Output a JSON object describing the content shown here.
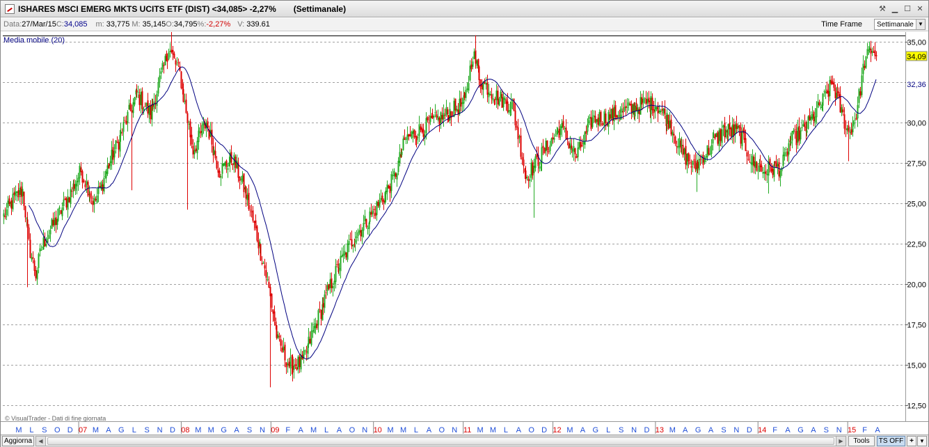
{
  "window": {
    "title": "ISHARES MSCI EMERG MKTS UCITS ETF (DIST) <34,085> -2,27%",
    "period": "(Settimanale)",
    "controls": [
      "tools-icon",
      "minimize-icon",
      "maximize-icon",
      "close-icon"
    ]
  },
  "info": {
    "date_label": "Data:",
    "date_value": "27/Mar/15",
    "close_label": "C:",
    "close_value": "34,085",
    "min_label": "m:",
    "min_value": "33,775",
    "max_label": "M:",
    "max_value": "35,145",
    "open_label": "O:",
    "open_value": "34,795",
    "pct_label": "%:",
    "pct_value": "-2,27%",
    "vol_label": "V:",
    "vol_value": "339.61",
    "timeframe_label": "Time Frame",
    "timeframe_value": "Settimanale"
  },
  "indicator_label": "Media mobile (20)",
  "watermark": "© VisualTrader - Dati di fine giornata",
  "statusbar": {
    "refresh": "Aggiorna",
    "tools": "Tools",
    "tsoff": "TS OFF",
    "plus": "+"
  },
  "colors": {
    "up": "#22aa22",
    "down": "#dd0000",
    "ma": "#000080",
    "grid": "#a0a0a0",
    "year": "#dd0000",
    "month": "#1f4ed8",
    "last_price_bg": "#ffff00"
  },
  "chart_data": {
    "type": "candlestick",
    "ylim": [
      11.5,
      35.6
    ],
    "yticks": [
      12.5,
      15.0,
      17.5,
      20.0,
      22.5,
      25.0,
      27.5,
      30.0,
      32.5,
      35.0
    ],
    "ytick_labels": [
      "12,50",
      "15,00",
      "17,50",
      "20,00",
      "22,50",
      "25,00",
      "27,50",
      "30,00",
      "32,50",
      "35,00"
    ],
    "last_price": 34.09,
    "last_price_label": "34,09",
    "ma_value": 32.36,
    "ma_label": "32,36",
    "ma_period": 20,
    "resistance": 35.38,
    "xticks": [
      {
        "l": "M",
        "y": false
      },
      {
        "l": "L",
        "y": false
      },
      {
        "l": "S",
        "y": false
      },
      {
        "l": "O",
        "y": false
      },
      {
        "l": "D",
        "y": false
      },
      {
        "l": "07",
        "y": true
      },
      {
        "l": "M",
        "y": false
      },
      {
        "l": "A",
        "y": false
      },
      {
        "l": "G",
        "y": false
      },
      {
        "l": "L",
        "y": false
      },
      {
        "l": "S",
        "y": false
      },
      {
        "l": "N",
        "y": false
      },
      {
        "l": "D",
        "y": false
      },
      {
        "l": "08",
        "y": true
      },
      {
        "l": "M",
        "y": false
      },
      {
        "l": "M",
        "y": false
      },
      {
        "l": "G",
        "y": false
      },
      {
        "l": "A",
        "y": false
      },
      {
        "l": "S",
        "y": false
      },
      {
        "l": "N",
        "y": false
      },
      {
        "l": "09",
        "y": true
      },
      {
        "l": "F",
        "y": false
      },
      {
        "l": "A",
        "y": false
      },
      {
        "l": "M",
        "y": false
      },
      {
        "l": "L",
        "y": false
      },
      {
        "l": "A",
        "y": false
      },
      {
        "l": "O",
        "y": false
      },
      {
        "l": "N",
        "y": false
      },
      {
        "l": "10",
        "y": true
      },
      {
        "l": "M",
        "y": false
      },
      {
        "l": "M",
        "y": false
      },
      {
        "l": "L",
        "y": false
      },
      {
        "l": "A",
        "y": false
      },
      {
        "l": "O",
        "y": false
      },
      {
        "l": "N",
        "y": false
      },
      {
        "l": "11",
        "y": true
      },
      {
        "l": "M",
        "y": false
      },
      {
        "l": "M",
        "y": false
      },
      {
        "l": "L",
        "y": false
      },
      {
        "l": "A",
        "y": false
      },
      {
        "l": "O",
        "y": false
      },
      {
        "l": "D",
        "y": false
      },
      {
        "l": "12",
        "y": true
      },
      {
        "l": "M",
        "y": false
      },
      {
        "l": "A",
        "y": false
      },
      {
        "l": "G",
        "y": false
      },
      {
        "l": "L",
        "y": false
      },
      {
        "l": "S",
        "y": false
      },
      {
        "l": "N",
        "y": false
      },
      {
        "l": "D",
        "y": false
      },
      {
        "l": "13",
        "y": true
      },
      {
        "l": "M",
        "y": false
      },
      {
        "l": "A",
        "y": false
      },
      {
        "l": "G",
        "y": false
      },
      {
        "l": "A",
        "y": false
      },
      {
        "l": "S",
        "y": false
      },
      {
        "l": "N",
        "y": false
      },
      {
        "l": "D",
        "y": false
      },
      {
        "l": "14",
        "y": true
      },
      {
        "l": "F",
        "y": false
      },
      {
        "l": "A",
        "y": false
      },
      {
        "l": "G",
        "y": false
      },
      {
        "l": "A",
        "y": false
      },
      {
        "l": "S",
        "y": false
      },
      {
        "l": "N",
        "y": false
      },
      {
        "l": "15",
        "y": true
      },
      {
        "l": "F",
        "y": false
      },
      {
        "l": "A",
        "y": false
      }
    ],
    "n_weeks": 460,
    "close_anchors": [
      [
        0,
        24.2
      ],
      [
        8,
        25.3
      ],
      [
        14,
        25.8
      ],
      [
        19,
        22.4
      ],
      [
        24,
        20.6
      ],
      [
        28,
        22.2
      ],
      [
        36,
        23.5
      ],
      [
        46,
        25.0
      ],
      [
        58,
        27.0
      ],
      [
        68,
        25.0
      ],
      [
        80,
        27.6
      ],
      [
        100,
        31.8
      ],
      [
        110,
        30.5
      ],
      [
        124,
        34.6
      ],
      [
        132,
        33.0
      ],
      [
        142,
        28.3
      ],
      [
        152,
        30.0
      ],
      [
        162,
        27.0
      ],
      [
        172,
        27.8
      ],
      [
        182,
        25.5
      ],
      [
        196,
        21.0
      ],
      [
        206,
        16.4
      ],
      [
        214,
        15.0
      ],
      [
        224,
        15.1
      ],
      [
        234,
        17.5
      ],
      [
        248,
        20.5
      ],
      [
        262,
        22.8
      ],
      [
        278,
        24.5
      ],
      [
        292,
        26.4
      ],
      [
        302,
        29.0
      ],
      [
        318,
        29.8
      ],
      [
        332,
        30.5
      ],
      [
        346,
        31.2
      ],
      [
        352,
        34.3
      ],
      [
        358,
        32.6
      ],
      [
        370,
        31.6
      ],
      [
        382,
        31.0
      ],
      [
        388,
        28.4
      ],
      [
        392,
        26.6
      ],
      [
        404,
        28.0
      ],
      [
        418,
        29.7
      ],
      [
        430,
        27.9
      ],
      [
        442,
        30.2
      ],
      [
        456,
        30.4
      ],
      [
        470,
        30.8
      ],
      [
        482,
        31.2
      ],
      [
        490,
        31.1
      ],
      [
        500,
        30.0
      ],
      [
        508,
        28.3
      ],
      [
        518,
        27.2
      ],
      [
        528,
        28.2
      ],
      [
        540,
        29.5
      ],
      [
        552,
        29.4
      ],
      [
        562,
        27.5
      ],
      [
        570,
        27.0
      ],
      [
        578,
        27.2
      ],
      [
        584,
        27.2
      ],
      [
        590,
        28.8
      ],
      [
        602,
        29.6
      ],
      [
        614,
        31.2
      ],
      [
        622,
        32.4
      ],
      [
        628,
        30.9
      ],
      [
        634,
        29.3
      ],
      [
        640,
        30.5
      ],
      [
        646,
        33.8
      ],
      [
        652,
        34.6
      ],
      [
        655,
        34.1
      ]
    ],
    "spikes": [
      {
        "i": 18,
        "low": 19.8
      },
      {
        "i": 96,
        "low": 25.8
      },
      {
        "i": 138,
        "low": 24.6
      },
      {
        "i": 200,
        "low": 13.6
      },
      {
        "i": 216,
        "low": 14.4
      },
      {
        "i": 126,
        "high": 35.6
      },
      {
        "i": 354,
        "high": 35.4
      },
      {
        "i": 398,
        "low": 24.1
      },
      {
        "i": 520,
        "low": 25.7
      },
      {
        "i": 574,
        "low": 25.6
      },
      {
        "i": 634,
        "low": 27.6
      }
    ]
  }
}
